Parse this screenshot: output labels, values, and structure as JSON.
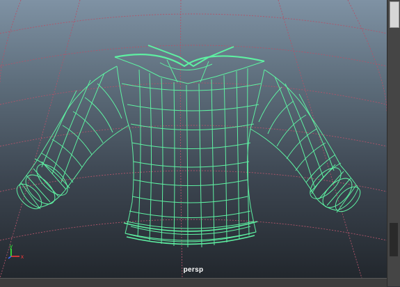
{
  "viewport": {
    "camera_name": "persp",
    "wireframe_color": "#5ef0a2",
    "grid_color": "#b0546a"
  },
  "axis_gizmo": {
    "x_label": "x",
    "y_label": "y",
    "z_label": "z",
    "x_color": "#ff3b3b",
    "y_color": "#3bff3b",
    "z_color": "#3b6bff"
  }
}
